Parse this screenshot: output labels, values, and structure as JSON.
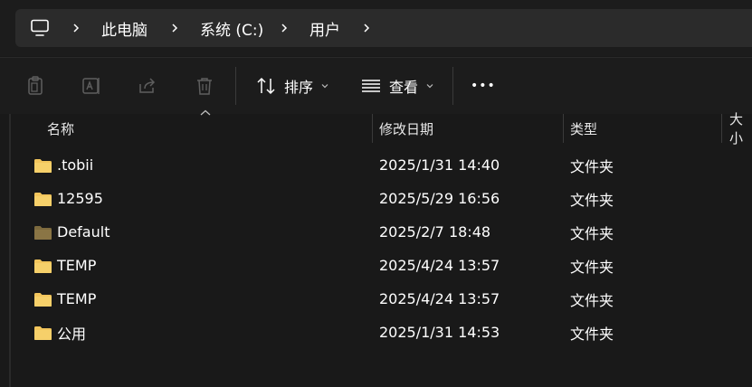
{
  "address_bar": {
    "crumbs": [
      "此电脑",
      "系统 (C:)",
      "用户"
    ]
  },
  "toolbar": {
    "sort_label": "排序",
    "view_label": "查看",
    "more_label": "•••"
  },
  "columns": {
    "name": "名称",
    "date": "修改日期",
    "type": "类型",
    "size": "大小"
  },
  "files": [
    {
      "name": ".tobii",
      "date": "2025/1/31 14:40",
      "type": "文件夹",
      "icon": "folder-icon"
    },
    {
      "name": "12595",
      "date": "2025/5/29 16:56",
      "type": "文件夹",
      "icon": "folder-icon"
    },
    {
      "name": "Default",
      "date": "2025/2/7 18:48",
      "type": "文件夹",
      "icon": "folder-dim-icon"
    },
    {
      "name": "TEMP",
      "date": "2025/4/24 13:57",
      "type": "文件夹",
      "icon": "folder-icon"
    },
    {
      "name": "TEMP",
      "date": "2025/4/24 13:57",
      "type": "文件夹",
      "icon": "folder-icon"
    },
    {
      "name": "公用",
      "date": "2025/1/31 14:53",
      "type": "文件夹",
      "icon": "folder-icon"
    }
  ],
  "colors": {
    "folder": "#f2c55c",
    "folder_dim": "#8a7545",
    "background": "#191919"
  }
}
